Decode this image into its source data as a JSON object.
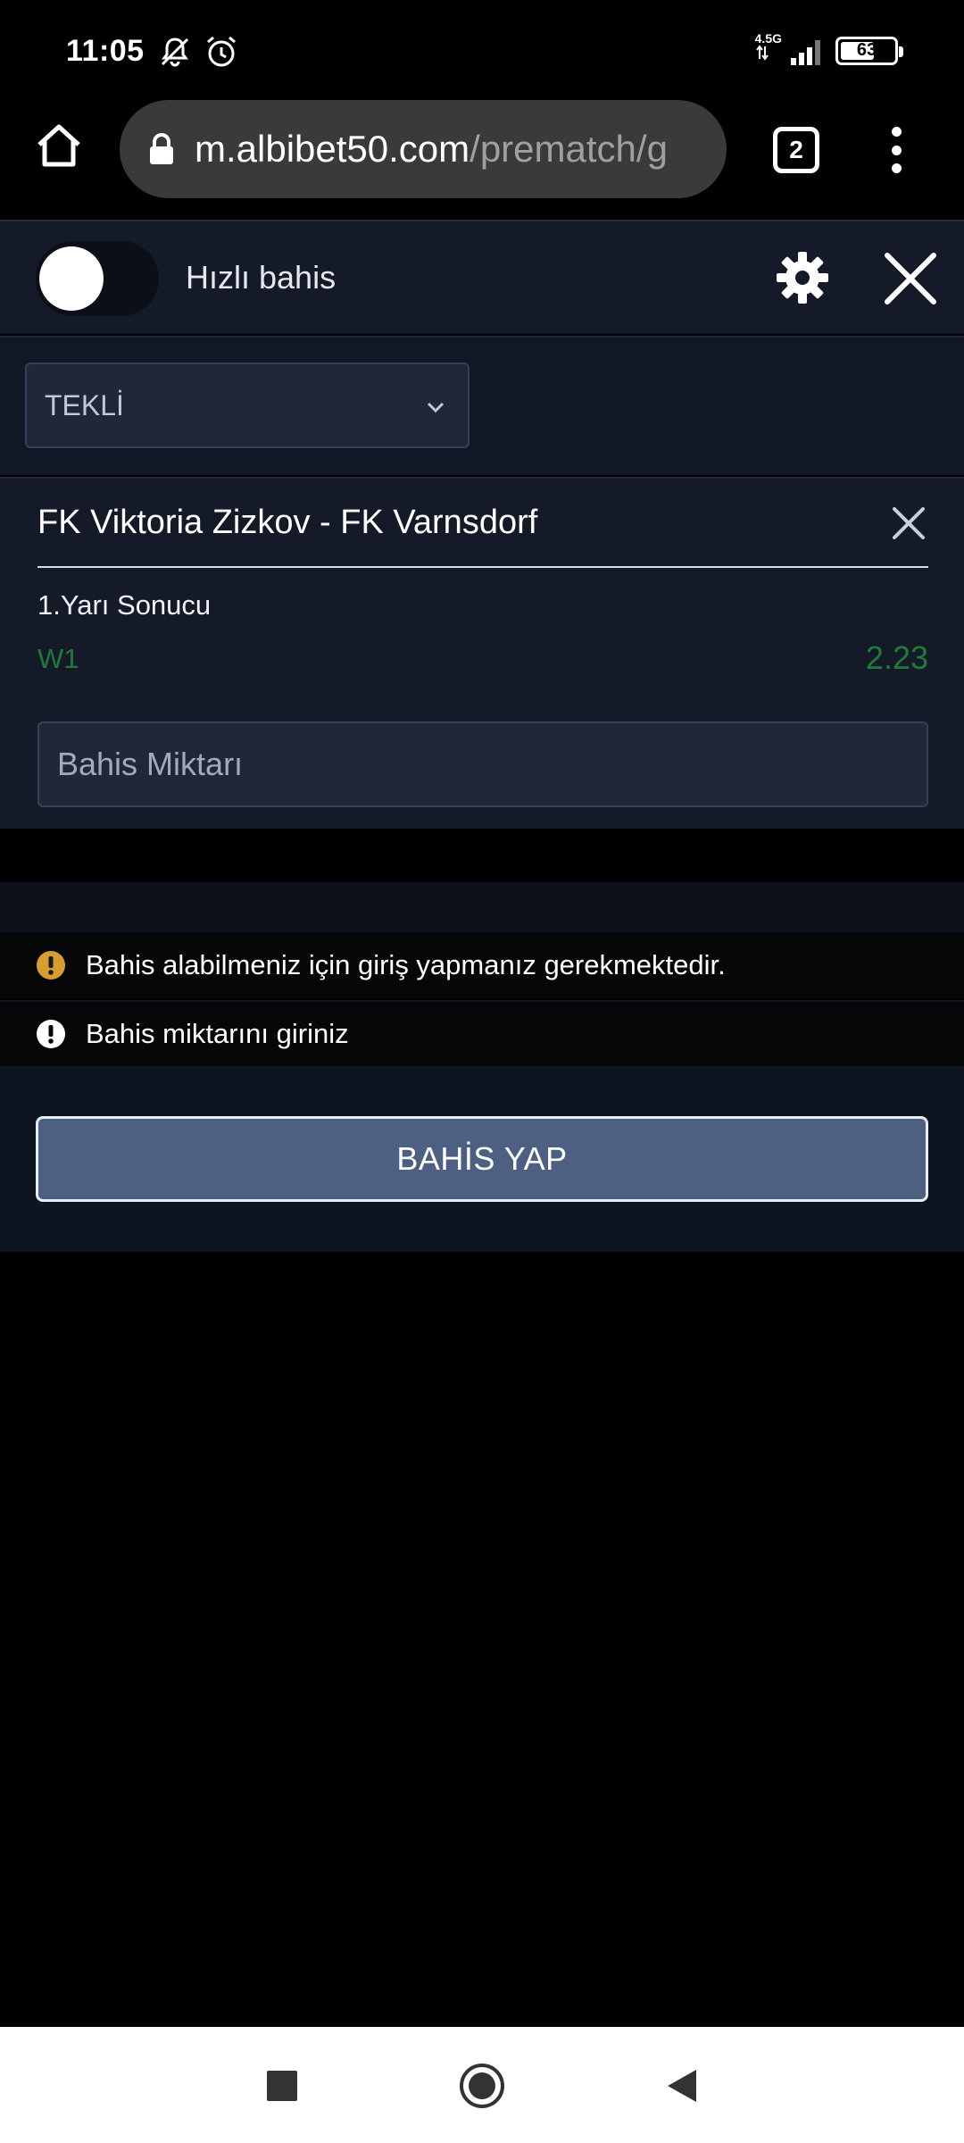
{
  "status_bar": {
    "time": "11:05",
    "network": "4.5G",
    "battery": "63",
    "battery_level_percent": 63
  },
  "browser": {
    "url_host": "m.albibet50.com",
    "url_path": "/prematch/g",
    "tab_count": "2"
  },
  "betslip": {
    "quick_bet_label": "Hızlı bahis",
    "bet_type": "TEKLİ",
    "match": "FK Viktoria Zizkov - FK Varnsdorf",
    "market": "1.Yarı Sonucu",
    "selection": "W1",
    "odds": "2.23",
    "stake_placeholder": "Bahis Miktarı",
    "messages": {
      "login_required": "Bahis alabilmeniz için giriş yapmanız gerekmektedir.",
      "enter_amount": "Bahis miktarını giriniz"
    },
    "place_bet_label": "BAHİS YAP"
  },
  "icons": {
    "warning": "warning-circle-icon",
    "info": "exclamation-circle-icon",
    "settings": "gear-icon",
    "close": "close-icon"
  },
  "colors": {
    "accent_green": "#1f7a3a",
    "warning_amber": "#d69e2e",
    "button_bg": "#4d6081"
  }
}
